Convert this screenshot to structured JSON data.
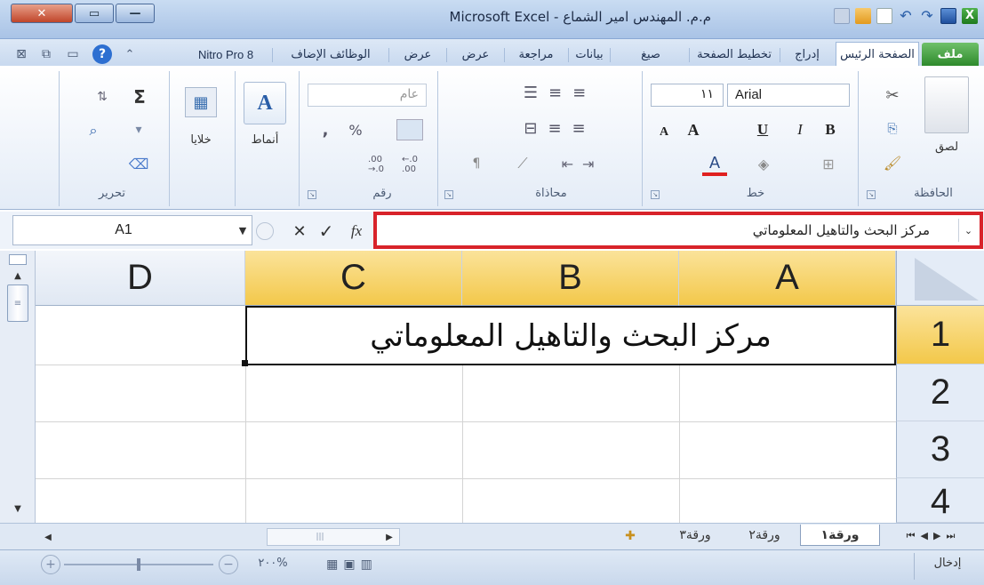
{
  "window": {
    "title": "م.م. المهندس امير الشماع - Microsoft Excel",
    "close_glyph": "✕",
    "maximize_glyph": "▭",
    "minimize_glyph": "—"
  },
  "tabs": {
    "file": "ملف",
    "home": "الصفحة الرئيس",
    "insert": "إدراج",
    "page_layout": "تخطيط الصفحة",
    "formulas": "صيغ",
    "data": "بيانات",
    "review": "مراجعة",
    "view": "عرض",
    "addins": "الوظائف الإضاف",
    "nitro": "Nitro Pro 8"
  },
  "ribbon": {
    "clipboard": {
      "label": "الحافظة",
      "paste": "لصق"
    },
    "font": {
      "label": "خط",
      "font_name": "Arial",
      "font_size": "١١",
      "bold": "B",
      "italic": "I",
      "underline": "U",
      "grow": "A",
      "shrink": "A"
    },
    "alignment": {
      "label": "محاذاة"
    },
    "number": {
      "label": "رقم",
      "format": "عام",
      "percent": "%",
      "comma": ",",
      "inc_decimal": ".00\n→.0",
      "dec_decimal": "←.0\n.00"
    },
    "styles": {
      "label": "أنماط"
    },
    "cells": {
      "label": "خلايا"
    },
    "editing": {
      "label": "تحرير",
      "sum": "Σ"
    }
  },
  "formula_bar": {
    "name_box": "A1",
    "cancel": "✕",
    "enter": "✓",
    "fx": "fx",
    "formula": "مركز البحث والتاهيل المعلوماتي"
  },
  "sheet": {
    "columns": [
      "A",
      "B",
      "C",
      "D"
    ],
    "rows": [
      "1",
      "2",
      "3",
      "4"
    ],
    "cell_A1": "مركز البحث والتاهيل المعلوماتي"
  },
  "sheet_tabs": [
    "ورقة١",
    "ورقة٢",
    "ورقة٣"
  ],
  "status": {
    "mode": "إدخال",
    "zoom": "%٢٠٠"
  },
  "colors": {
    "highlight_border": "#d8232a",
    "selected_header": "#f9d65a",
    "file_tab": "#3a9a36"
  }
}
